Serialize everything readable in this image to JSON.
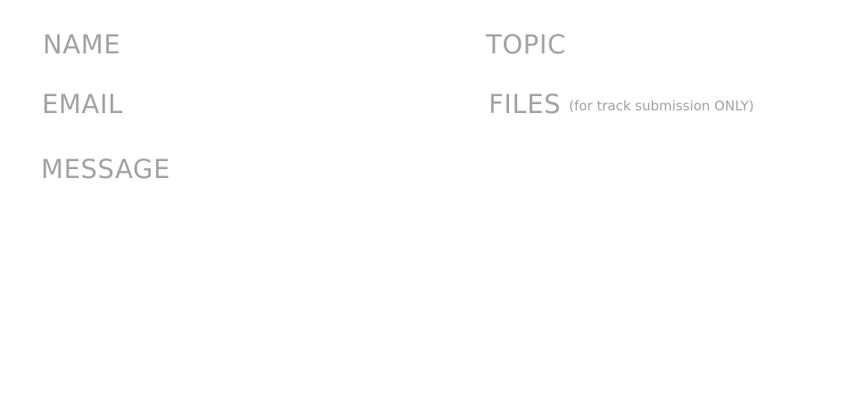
{
  "form": {
    "name_placeholder": "NAME",
    "topic_placeholder": "TOPIC",
    "email_placeholder": "EMAIL",
    "files_label": "FILES",
    "files_note": "(for track submission ONLY)",
    "message_placeholder": "MESSAGE"
  },
  "colors": {
    "text": "#a3a3a3",
    "background": "#ffffff"
  }
}
